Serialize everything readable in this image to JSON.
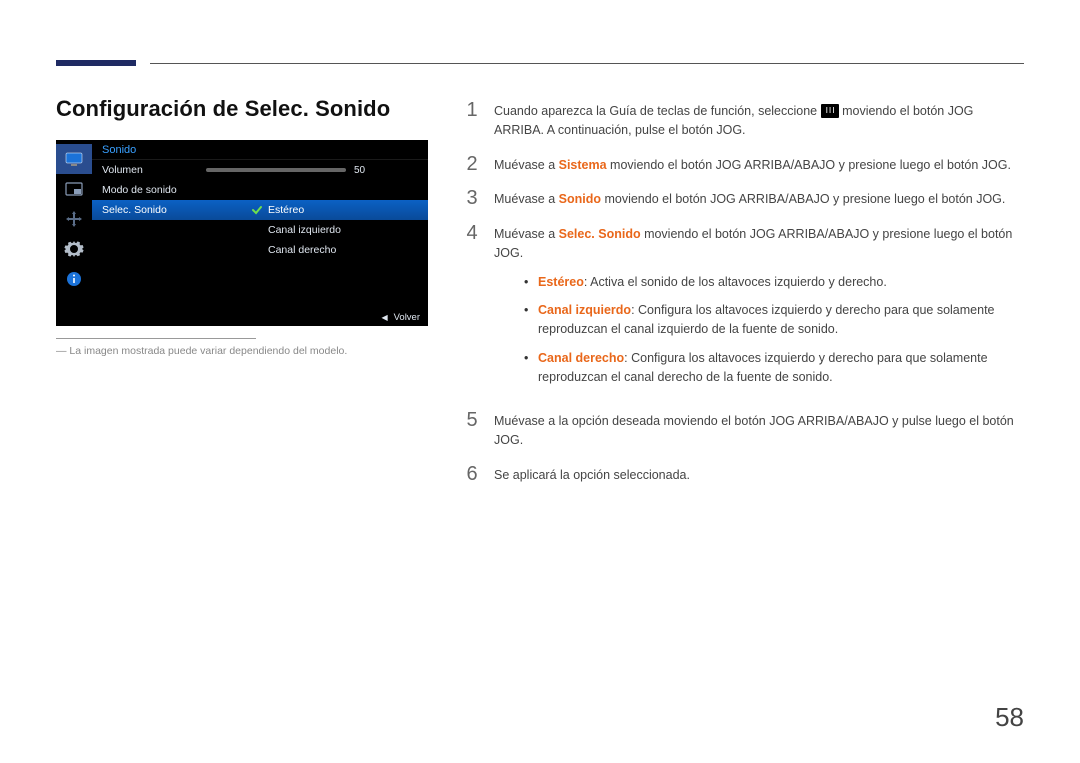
{
  "page_number": "58",
  "title": "Configuración de Selec. Sonido",
  "caption": "La imagen mostrada puede variar dependiendo del modelo.",
  "osd": {
    "header": "Sonido",
    "row_volume_label": "Volumen",
    "row_volume_value": "50",
    "row_mode_label": "Modo de sonido",
    "row_select_label": "Selec. Sonido",
    "sub_options": [
      "Estéreo",
      "Canal izquierdo",
      "Canal derecho"
    ],
    "footer_back": "Volver"
  },
  "steps": {
    "s1_a": "Cuando aparezca la Guía de teclas de función, seleccione ",
    "s1_b": " moviendo el botón JOG ARRIBA. A continuación, pulse el botón JOG.",
    "s2_a": "Muévase a ",
    "s2_term": "Sistema",
    "s2_b": " moviendo el botón JOG ARRIBA/ABAJO y presione luego el botón JOG.",
    "s3_a": "Muévase a ",
    "s3_term": "Sonido",
    "s3_b": " moviendo el botón JOG ARRIBA/ABAJO y presione luego el botón JOG.",
    "s4_a": "Muévase a ",
    "s4_term": "Selec. Sonido",
    "s4_b": " moviendo el botón JOG ARRIBA/ABAJO y presione luego el botón JOG.",
    "s5": "Muévase a la opción deseada moviendo el botón JOG ARRIBA/ABAJO y pulse luego el botón JOG.",
    "s6": "Se aplicará la opción seleccionada."
  },
  "bullets": {
    "b1_term": "Estéreo",
    "b1_text": ": Activa el sonido de los altavoces izquierdo y derecho.",
    "b2_term": "Canal izquierdo",
    "b2_text": ": Configura los altavoces izquierdo y derecho para que solamente reproduzcan el canal izquierdo de la fuente de sonido.",
    "b3_term": "Canal derecho",
    "b3_text": ": Configura los altavoces izquierdo y derecho para que solamente reproduzcan el canal derecho de la fuente de sonido."
  }
}
